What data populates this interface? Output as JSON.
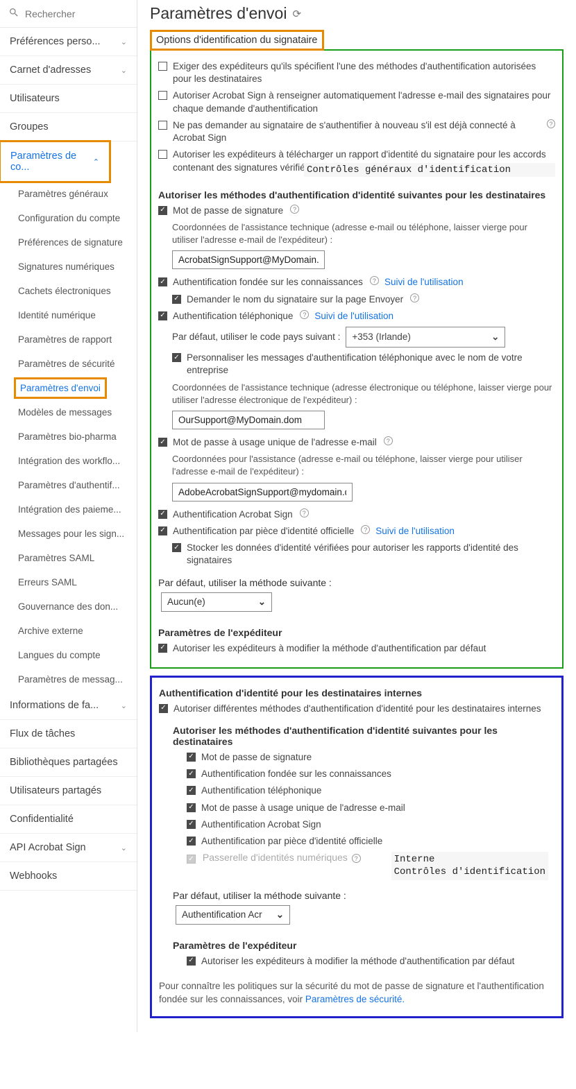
{
  "search": {
    "placeholder": "Rechercher"
  },
  "sidebar": {
    "top": [
      {
        "label": "Préférences perso...",
        "expandable": true
      },
      {
        "label": "Carnet d'adresses",
        "expandable": true
      },
      {
        "label": "Utilisateurs",
        "expandable": false
      },
      {
        "label": "Groupes",
        "expandable": false
      }
    ],
    "accountSettings": {
      "label": "Paramètres de co..."
    },
    "subs": [
      "Paramètres généraux",
      "Configuration du compte",
      "Préférences de signature",
      "Signatures numériques",
      "Cachets électroniques",
      "Identité numérique",
      "Paramètres de rapport",
      "Paramètres de sécurité"
    ],
    "activeSub": "Paramètres d'envoi",
    "subs2": [
      "Modèles de messages",
      "Paramètres bio-pharma",
      "Intégration des workflo...",
      "Paramètres d'authentif...",
      "Intégration des paieme...",
      "Messages pour les sign...",
      "Paramètres SAML",
      "Erreurs SAML",
      "Gouvernance des don...",
      "Archive externe",
      "Langues du compte",
      "Paramètres de messag..."
    ],
    "bottom": [
      {
        "label": "Informations de fa...",
        "expandable": true
      },
      {
        "label": "Flux de tâches",
        "expandable": false
      },
      {
        "label": "Bibliothèques partagées",
        "expandable": false
      },
      {
        "label": "Utilisateurs partagés",
        "expandable": false
      },
      {
        "label": "Confidentialité",
        "expandable": false
      },
      {
        "label": "API Acrobat Sign",
        "expandable": true
      },
      {
        "label": "Webhooks",
        "expandable": false
      }
    ]
  },
  "main": {
    "title": "Paramètres d'envoi",
    "sectionTitle": "Options d'identification du signataire",
    "annotation1": "Contrôles généraux d'identification",
    "annotation2": "Interne\nContrôles d'identification",
    "general": {
      "c1": "Exiger des expéditeurs qu'ils spécifient l'une des méthodes d'authentification autorisées pour les destinataires",
      "c2": "Autoriser Acrobat Sign à renseigner automatiquement l'adresse e-mail des signataires pour chaque demande d'authentification",
      "c3": "Ne pas demander au signataire de s'authentifier à nouveau s'il est déjà connecté à Acrobat Sign",
      "c4": "Autoriser les expéditeurs à télécharger un rapport d'identité du signataire pour les accords contenant des signatures vérifiées"
    },
    "methodsHeading": "Autoriser les méthodes d'authentification d'identité suivantes pour les destinataires",
    "m1": {
      "label": "Mot de passe de signature"
    },
    "supportDesc1": "Coordonnées de l'assistance technique (adresse e-mail ou téléphone, laisser vierge pour utiliser l'adresse e-mail de l'expéditeur) :",
    "supportInput1": "AcrobatSignSupport@MyDomain.dom",
    "m2": {
      "label": "Authentification fondée sur les connaissances",
      "link": "Suivi de l'utilisation"
    },
    "m2sub": "Demander le nom du signataire sur la page Envoyer",
    "m3": {
      "label": "Authentification téléphonique",
      "link": "Suivi de l'utilisation"
    },
    "m3countryLabel": "Par défaut, utiliser le code pays suivant :",
    "m3countryValue": "+353 (Irlande)",
    "m3sub": "Personnaliser les messages d'authentification téléphonique avec le nom de votre entreprise",
    "supportDesc2": "Coordonnées de l'assistance technique (adresse électronique ou téléphone, laisser vierge pour utiliser l'adresse électronique de l'expéditeur) :",
    "supportInput2": "OurSupport@MyDomain.dom",
    "m4": {
      "label": "Mot de passe à usage unique de l'adresse e-mail"
    },
    "supportDesc3": "Coordonnées pour l'assistance (adresse e-mail ou téléphone, laisser vierge pour utiliser l'adresse e-mail de l'expéditeur) :",
    "supportInput3": "AdobeAcrobatSignSupport@mydomain.dor",
    "m5": {
      "label": "Authentification Acrobat Sign"
    },
    "m6": {
      "label": "Authentification par pièce d'identité officielle",
      "link": "Suivi de l'utilisation"
    },
    "m6sub": "Stocker les données d'identité vérifiées pour autoriser les rapports d'identité des signataires",
    "defaultMethodLabel": "Par défaut, utiliser la méthode suivante :",
    "defaultMethodValue": "Aucun(e)",
    "senderHeading": "Paramètres de l'expéditeur",
    "senderOpt": "Autoriser les expéditeurs à modifier la méthode d'authentification par défaut",
    "internal": {
      "heading": "Authentification d'identité pour les destinataires internes",
      "opt": "Autoriser différentes méthodes d'authentification d'identité pour les destinataires internes",
      "methodsHeading": "Autoriser les méthodes d'authentification d'identité suivantes pour les destinataires",
      "i1": "Mot de passe de signature",
      "i2": "Authentification fondée sur les connaissances",
      "i3": "Authentification téléphonique",
      "i4": "Mot de passe à usage unique de l'adresse e-mail",
      "i5": "Authentification Acrobat Sign",
      "i6": "Authentification par pièce d'identité officielle",
      "i7": "Passerelle d'identités numériques",
      "defaultLabel": "Par défaut, utiliser la méthode suivante :",
      "defaultValue": "Authentification Acr",
      "senderHeading": "Paramètres de l'expéditeur",
      "senderOpt": "Autoriser les expéditeurs à modifier la méthode d'authentification par défaut"
    },
    "footer": {
      "text": "Pour connaître les politiques sur la sécurité du mot de passe de signature et l'authentification fondée sur les connaissances, voir ",
      "link": "Paramètres de sécurité."
    }
  }
}
